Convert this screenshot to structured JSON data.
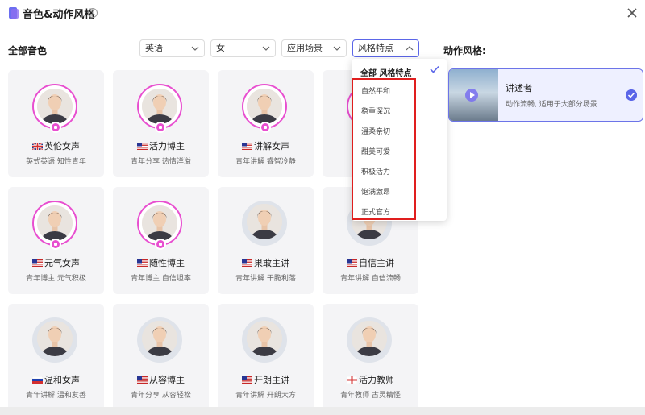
{
  "header": {
    "title": "音色&动作风格",
    "info_icon": "info-icon",
    "close_icon": "close-icon"
  },
  "voices": {
    "section_title": "全部音色",
    "filters": [
      {
        "value": "英语"
      },
      {
        "value": "女"
      },
      {
        "value": "应用场景"
      },
      {
        "value": "风格特点"
      }
    ],
    "cards": [
      {
        "name": "英伦女声",
        "desc": "英式英语 知性青年",
        "flag": "uk",
        "ring": true
      },
      {
        "name": "活力博主",
        "desc": "青年分享 热情洋溢",
        "flag": "us",
        "ring": true
      },
      {
        "name": "讲解女声",
        "desc": "青年讲解 睿智冷静",
        "flag": "us",
        "ring": true
      },
      {
        "name": "",
        "desc": "",
        "flag": "us",
        "ring": true
      },
      {
        "name": "元气女声",
        "desc": "青年博主 元气积极",
        "flag": "us",
        "ring": true
      },
      {
        "name": "随性博主",
        "desc": "青年博主 自信坦率",
        "flag": "us",
        "ring": true
      },
      {
        "name": "果敢主讲",
        "desc": "青年讲解 干脆利落",
        "flag": "us",
        "ring": false
      },
      {
        "name": "自信主讲",
        "desc": "青年讲解 自信流畅",
        "flag": "us",
        "ring": false
      },
      {
        "name": "温和女声",
        "desc": "青年讲解 温和友善",
        "flag": "ru",
        "ring": false
      },
      {
        "name": "从容博主",
        "desc": "青年分享 从容轻松",
        "flag": "us",
        "ring": false
      },
      {
        "name": "开朗主讲",
        "desc": "青年讲解 开朗大方",
        "flag": "us",
        "ring": false
      },
      {
        "name": "活力教师",
        "desc": "青年教师 古灵精怪",
        "flag": "ge",
        "ring": false
      }
    ]
  },
  "dropdown": {
    "header": "全部 风格特点",
    "items": [
      "自然平和",
      "稳重深沉",
      "温柔亲切",
      "甜美可爱",
      "积极活力",
      "饱满激昂",
      "正式官方"
    ]
  },
  "styles": {
    "section_title": "动作风格:",
    "selected": {
      "name": "讲述者",
      "desc": "动作流畅, 适用于大部分场景"
    }
  },
  "colors": {
    "accent": "#5b66e8",
    "ring": "#e84fd0",
    "highlight_box": "#e01e1e"
  }
}
